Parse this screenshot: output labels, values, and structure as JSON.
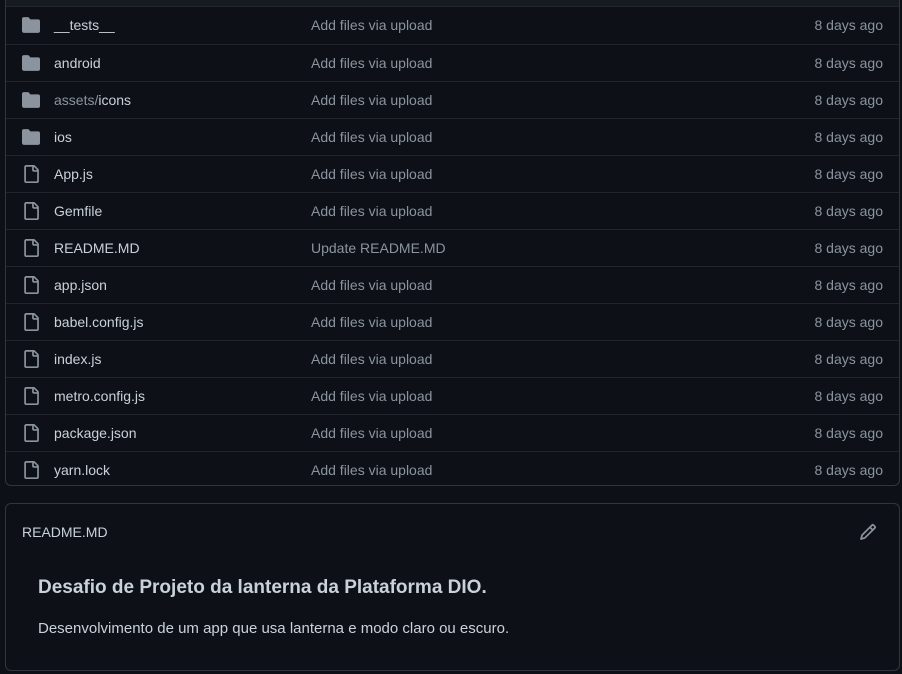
{
  "files": [
    {
      "type": "folder",
      "name": "__tests__",
      "name_dim": "",
      "message": "Add files via upload",
      "age": "8 days ago"
    },
    {
      "type": "folder",
      "name": "android",
      "name_dim": "",
      "message": "Add files via upload",
      "age": "8 days ago"
    },
    {
      "type": "folder",
      "name": "icons",
      "name_dim": "assets/",
      "message": "Add files via upload",
      "age": "8 days ago"
    },
    {
      "type": "folder",
      "name": "ios",
      "name_dim": "",
      "message": "Add files via upload",
      "age": "8 days ago"
    },
    {
      "type": "file",
      "name": "App.js",
      "name_dim": "",
      "message": "Add files via upload",
      "age": "8 days ago"
    },
    {
      "type": "file",
      "name": "Gemfile",
      "name_dim": "",
      "message": "Add files via upload",
      "age": "8 days ago"
    },
    {
      "type": "file",
      "name": "README.MD",
      "name_dim": "",
      "message": "Update README.MD",
      "age": "8 days ago"
    },
    {
      "type": "file",
      "name": "app.json",
      "name_dim": "",
      "message": "Add files via upload",
      "age": "8 days ago"
    },
    {
      "type": "file",
      "name": "babel.config.js",
      "name_dim": "",
      "message": "Add files via upload",
      "age": "8 days ago"
    },
    {
      "type": "file",
      "name": "index.js",
      "name_dim": "",
      "message": "Add files via upload",
      "age": "8 days ago"
    },
    {
      "type": "file",
      "name": "metro.config.js",
      "name_dim": "",
      "message": "Add files via upload",
      "age": "8 days ago"
    },
    {
      "type": "file",
      "name": "package.json",
      "name_dim": "",
      "message": "Add files via upload",
      "age": "8 days ago"
    },
    {
      "type": "file",
      "name": "yarn.lock",
      "name_dim": "",
      "message": "Add files via upload",
      "age": "8 days ago"
    }
  ],
  "readme": {
    "title": "README.MD",
    "edit_icon": "pencil-icon",
    "heading": "Desafio de Projeto da lanterna da Plataforma DIO.",
    "paragraph": "Desenvolvimento de um app que usa lanterna e modo claro ou escuro."
  },
  "colors": {
    "background": "#0d1117",
    "folder_icon": "#8b949e",
    "file_icon": "#8b949e",
    "border": "#30363d",
    "text": "#c9d1d9",
    "muted": "#8b949e"
  }
}
